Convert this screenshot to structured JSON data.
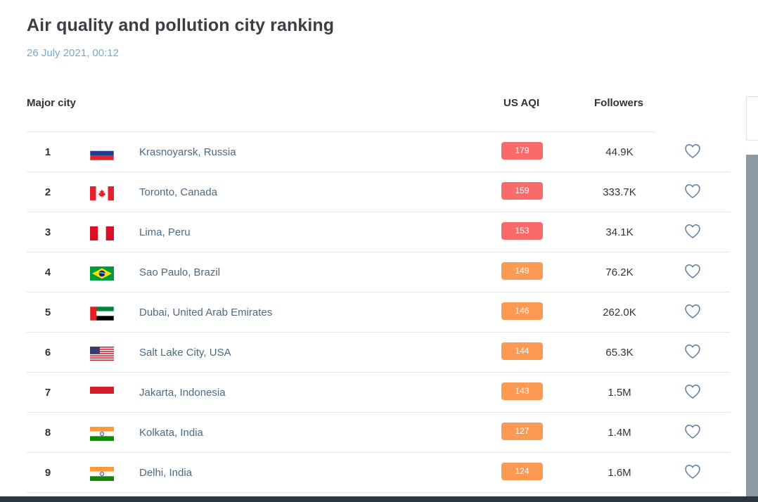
{
  "title": "Air quality and pollution city ranking",
  "timestamp": "26 July 2021, 00:12",
  "columns": {
    "city": "Major city",
    "aqi": "US AQI",
    "followers": "Followers"
  },
  "colors": {
    "unhealthy": "#f96a6b",
    "sensitive": "#fc9a54"
  },
  "rows": [
    {
      "rank": "1",
      "flag": "russia-flag",
      "city": "Krasnoyarsk, Russia",
      "aqi": "179",
      "level": "unhealthy",
      "followers": "44.9K"
    },
    {
      "rank": "2",
      "flag": "canada-flag",
      "city": "Toronto, Canada",
      "aqi": "159",
      "level": "unhealthy",
      "followers": "333.7K"
    },
    {
      "rank": "3",
      "flag": "peru-flag",
      "city": "Lima, Peru",
      "aqi": "153",
      "level": "unhealthy",
      "followers": "34.1K"
    },
    {
      "rank": "4",
      "flag": "brazil-flag",
      "city": "Sao Paulo, Brazil",
      "aqi": "149",
      "level": "sensitive",
      "followers": "76.2K"
    },
    {
      "rank": "5",
      "flag": "uae-flag",
      "city": "Dubai, United Arab Emirates",
      "aqi": "146",
      "level": "sensitive",
      "followers": "262.0K"
    },
    {
      "rank": "6",
      "flag": "usa-flag",
      "city": "Salt Lake City, USA",
      "aqi": "144",
      "level": "sensitive",
      "followers": "65.3K"
    },
    {
      "rank": "7",
      "flag": "indonesia-flag",
      "city": "Jakarta, Indonesia",
      "aqi": "143",
      "level": "sensitive",
      "followers": "1.5M"
    },
    {
      "rank": "8",
      "flag": "india-flag",
      "city": "Kolkata, India",
      "aqi": "127",
      "level": "sensitive",
      "followers": "1.4M"
    },
    {
      "rank": "9",
      "flag": "india-flag",
      "city": "Delhi, India",
      "aqi": "124",
      "level": "sensitive",
      "followers": "1.6M"
    }
  ]
}
